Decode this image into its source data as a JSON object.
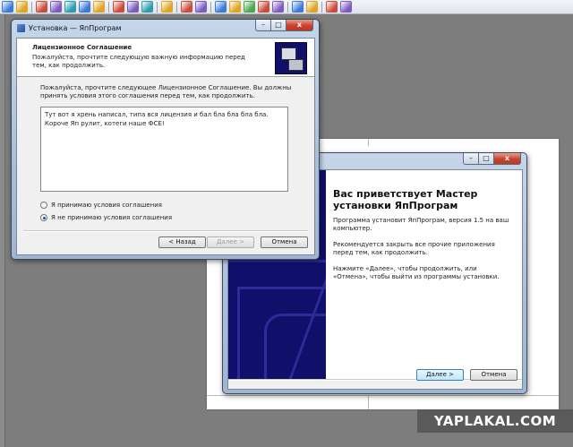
{
  "toolbar": {
    "icons": [
      "fence-icon",
      "folder-open-icon",
      "separator",
      "save-icon",
      "undo-icon",
      "cut-icon",
      "copy-icon",
      "paste-icon",
      "separator",
      "zoom-icon",
      "new-file-icon",
      "properties-icon",
      "separator",
      "delete-icon",
      "separator",
      "zoom-in-icon",
      "zoom-out-icon",
      "separator",
      "back-icon",
      "forward-icon",
      "page-icon",
      "pages-icon",
      "paint-icon",
      "separator",
      "page-view-icon",
      "folder-icon",
      "separator",
      "binoculars-icon",
      "replace-icon"
    ]
  },
  "license_window": {
    "title": "Установка — ЯпПрограм",
    "header_title": "Лицензионное Соглашение",
    "header_subtitle": "Пожалуйста, прочтите следующую важную информацию перед тем, как продолжить.",
    "intro": "Пожалуйста, прочтите следующее Лицензионное Соглашение. Вы должны принять условия этого соглашения перед тем, как продолжить.",
    "license_text": "Тут вот я хрень написал, типа вся лицензия и бал бла бла бла бла. Короче Яп рулит, котеги наше ФСЕ!",
    "accept_label": "Я принимаю условия соглашения",
    "decline_label": "Я не принимаю условия соглашения",
    "selected": "decline",
    "back_label": "< Назад",
    "next_label": "Далее >",
    "cancel_label": "Отмена"
  },
  "welcome_window": {
    "title": "Вас приветствует Мастер установки ЯпПрограм",
    "text1": "Программа установит ЯпПрограм, версия 1.5 на ваш компьютер.",
    "text2": "Рекомендуется закрыть все прочие приложения перед тем, как продолжить.",
    "text3": "Нажмите «Далее», чтобы продолжить, или «Отмена», чтобы выйти из программы установки.",
    "next_label": "Далее >",
    "cancel_label": "Отмена"
  },
  "window_controls": {
    "minimize": "–",
    "maximize": "□",
    "close": "x"
  },
  "watermark": "YAPLAKAL.COM",
  "colors": {
    "wizard_blue": "#10106a",
    "toolbar": "#e6eaf1",
    "background": "#7d7d7d"
  }
}
